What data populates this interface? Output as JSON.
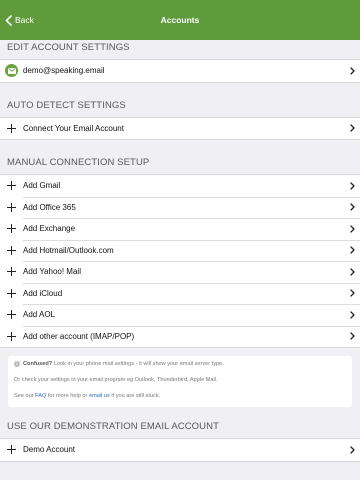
{
  "navbar": {
    "back_label": "Back",
    "title": "Accounts",
    "color": "#5f9a3b"
  },
  "sections": {
    "edit": {
      "header": "EDIT ACCOUNT SETTINGS",
      "items": [
        {
          "label": "demo@speaking.email",
          "icon": "mail-icon"
        }
      ]
    },
    "auto": {
      "header": "AUTO DETECT SETTINGS",
      "items": [
        {
          "label": "Connect Your Email Account",
          "icon": "plus-icon"
        }
      ]
    },
    "manual": {
      "header": "MANUAL CONNECTION SETUP",
      "items": [
        {
          "label": "Add Gmail",
          "icon": "plus-icon"
        },
        {
          "label": "Add Office 365",
          "icon": "plus-icon"
        },
        {
          "label": "Add Exchange",
          "icon": "plus-icon"
        },
        {
          "label": "Add Hotmail/Outlook.com",
          "icon": "plus-icon"
        },
        {
          "label": "Add Yahoo! Mail",
          "icon": "plus-icon"
        },
        {
          "label": "Add iCloud",
          "icon": "plus-icon"
        },
        {
          "label": "Add AOL",
          "icon": "plus-icon"
        },
        {
          "label": "Add other account (IMAP/POP)",
          "icon": "plus-icon"
        }
      ]
    },
    "demo": {
      "header": "USE OUR DEMONSTRATION EMAIL ACCOUNT",
      "items": [
        {
          "label": "Demo Account",
          "icon": "plus-icon"
        }
      ]
    }
  },
  "help": {
    "info_icon": "i",
    "line1_bold": "Confused?",
    "line1_rest": " Look in your phone mail settings - it will show your email server type.",
    "line2": "Or check your settings in your email program eg Outlook, Thunderbird, Apple Mail.",
    "line3_pre": "See our ",
    "faq_link": "FAQ",
    "line3_mid": " for more help or ",
    "email_link": "email us",
    "line3_post": " if you are still stuck."
  }
}
